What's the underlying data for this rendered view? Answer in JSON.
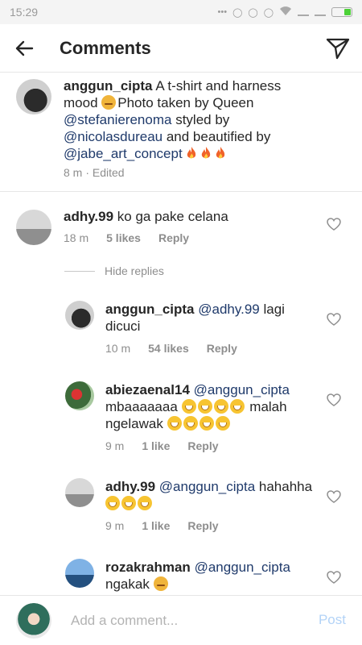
{
  "status_bar": {
    "time": "15:29"
  },
  "header": {
    "title": "Comments"
  },
  "caption": {
    "username": "anggun_cipta",
    "text_1": "A t-shirt and harness mood",
    "text_2": "Photo taken by Queen",
    "mention_1": "@stefanierenoma",
    "text_3": "styled by",
    "mention_2": "@nicolasdureau",
    "text_4": "and beautified by",
    "mention_3": "@jabe_art_concept",
    "time": "8 m",
    "edited": "· Edited"
  },
  "comment": {
    "username": "adhy.99",
    "text": "ko ga pake celana",
    "time": "18 m",
    "likes": "5 likes",
    "reply": "Reply"
  },
  "hide_replies": "Hide replies",
  "replies": [
    {
      "username": "anggun_cipta",
      "mention": "@adhy.99",
      "text": "lagi dicuci",
      "time": "10 m",
      "likes": "54 likes",
      "reply": "Reply"
    },
    {
      "username": "abiezaenal14",
      "mention": "@anggun_cipta",
      "text_a": "mbaaaaaaa",
      "text_b": "malah ngelawak",
      "time": "9 m",
      "likes": "1 like",
      "reply": "Reply"
    },
    {
      "username": "adhy.99",
      "mention": "@anggun_cipta",
      "text": "hahahha",
      "time": "9 m",
      "likes": "1 like",
      "reply": "Reply"
    },
    {
      "username": "rozakrahman",
      "mention": "@anggun_cipta",
      "text": "ngakak"
    }
  ],
  "composer": {
    "placeholder": "Add a comment...",
    "post": "Post"
  }
}
